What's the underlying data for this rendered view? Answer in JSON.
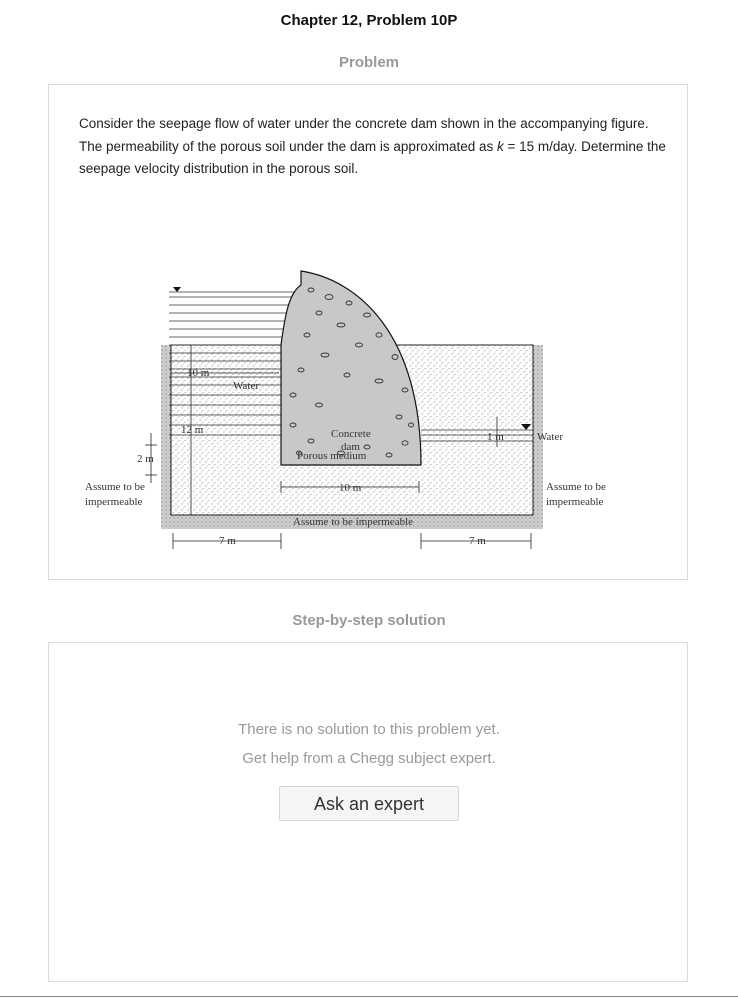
{
  "header": {
    "chapter_title": "Chapter 12, Problem 10P"
  },
  "problem": {
    "heading": "Problem",
    "text_before_k": "Consider the seepage flow of water under the concrete dam shown in the accompanying figure. The permeability of the porous soil under the dam is approximated as ",
    "k_symbol": "k",
    "text_after_k": " = 15 m/day. Determine the seepage velocity distribution in the porous soil.",
    "figure_labels": {
      "water_left": "Water",
      "water_right": "Water",
      "width_10m_top": "10 m",
      "dam_line1": "Concrete",
      "dam_line2": "dam",
      "dam_width": "10 m",
      "depth_2m": "2 m",
      "depth_1m": "1 m",
      "depth_12m": "12 m",
      "porous": "Porous medium",
      "impermeable_left_1": "Assume to be",
      "impermeable_left_2": "impermeable",
      "impermeable_right_1": "Assume to be",
      "impermeable_right_2": "impermeable",
      "impermeable_bottom": "Assume to be impermeable",
      "width_7m_left": "7 m",
      "width_7m_right": "7 m"
    }
  },
  "solution": {
    "heading": "Step-by-step solution",
    "line1": "There is no solution to this problem yet.",
    "line2": "Get help from a Chegg subject expert.",
    "ask_button": "Ask an expert"
  }
}
